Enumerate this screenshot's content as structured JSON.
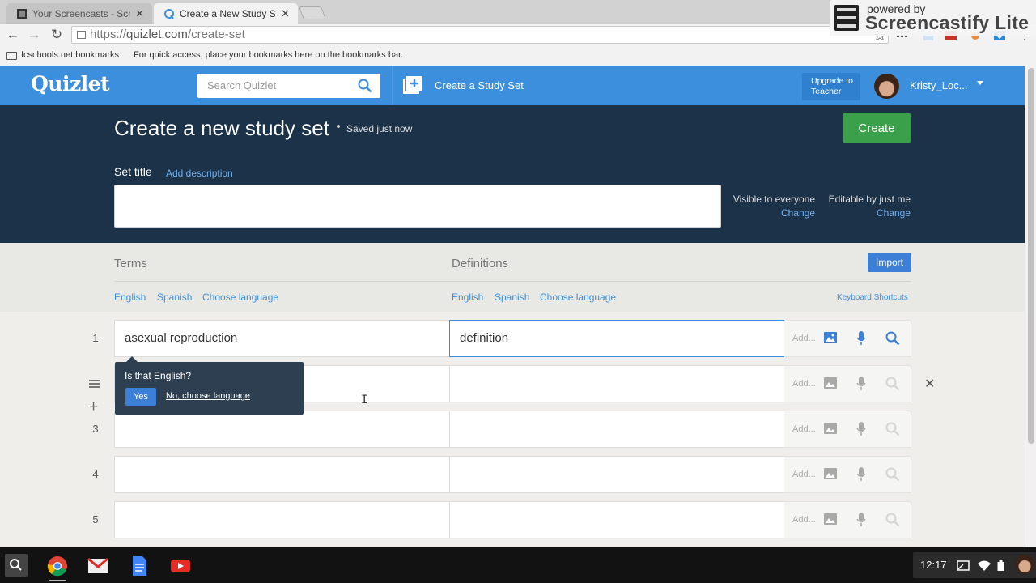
{
  "browser": {
    "tabs": [
      {
        "title": "Your Screencasts - Screencastify",
        "active": false
      },
      {
        "title": "Create a New Study Set | Quizlet",
        "active": true
      }
    ],
    "url": {
      "scheme": "https://",
      "host": "quizlet.com",
      "path": "/create-set"
    },
    "bookmarks_folder": "fcschools.net bookmarks",
    "bookmarks_hint": "For quick access, place your bookmarks here on the bookmarks bar."
  },
  "watermark": {
    "powered_by": "powered by",
    "name": "Screencastify Lite"
  },
  "header": {
    "logo": "Quizlet",
    "search_placeholder": "Search Quizlet",
    "create_link": "Create a Study Set",
    "upgrade_label": "Upgrade to Teacher",
    "username": "Kristy_Loc..."
  },
  "page": {
    "title": "Create a new study set",
    "saved_status": "Saved just now",
    "create_button": "Create",
    "set_title_label": "Set title",
    "add_description": "Add description",
    "set_title_value": "",
    "visibility": {
      "label": "Visible to everyone",
      "change": "Change"
    },
    "editability": {
      "label": "Editable by just me",
      "change": "Change"
    }
  },
  "columns": {
    "terms": "Terms",
    "definitions": "Definitions",
    "import_button": "Import",
    "term_languages": [
      "English",
      "Spanish",
      "Choose language"
    ],
    "definition_languages": [
      "English",
      "Spanish",
      "Choose language"
    ],
    "keyboard_shortcuts": "Keyboard Shortcuts"
  },
  "cards": [
    {
      "number": "1",
      "term": "asexual reproduction",
      "definition": "definition",
      "add": "Add..."
    },
    {
      "number": "2",
      "term": "",
      "definition": "",
      "add": "Add..."
    },
    {
      "number": "3",
      "term": "",
      "definition": "",
      "add": "Add..."
    },
    {
      "number": "4",
      "term": "",
      "definition": "",
      "add": "Add..."
    },
    {
      "number": "5",
      "term": "",
      "definition": "",
      "add": "Add..."
    }
  ],
  "language_popup": {
    "question": "Is that English?",
    "yes": "Yes",
    "no": "No, choose language"
  },
  "shelf": {
    "time": "12:17"
  },
  "colors": {
    "quizlet_blue": "#3b8fdc",
    "band_navy": "#1c3249",
    "create_green": "#3aa04a",
    "import_blue": "#3b7fd6"
  },
  "icons": [
    "search-icon",
    "create-set-icon",
    "image-icon",
    "microphone-icon",
    "magnifier-icon",
    "drag-handle-icon",
    "add-row-icon",
    "delete-row-icon"
  ]
}
